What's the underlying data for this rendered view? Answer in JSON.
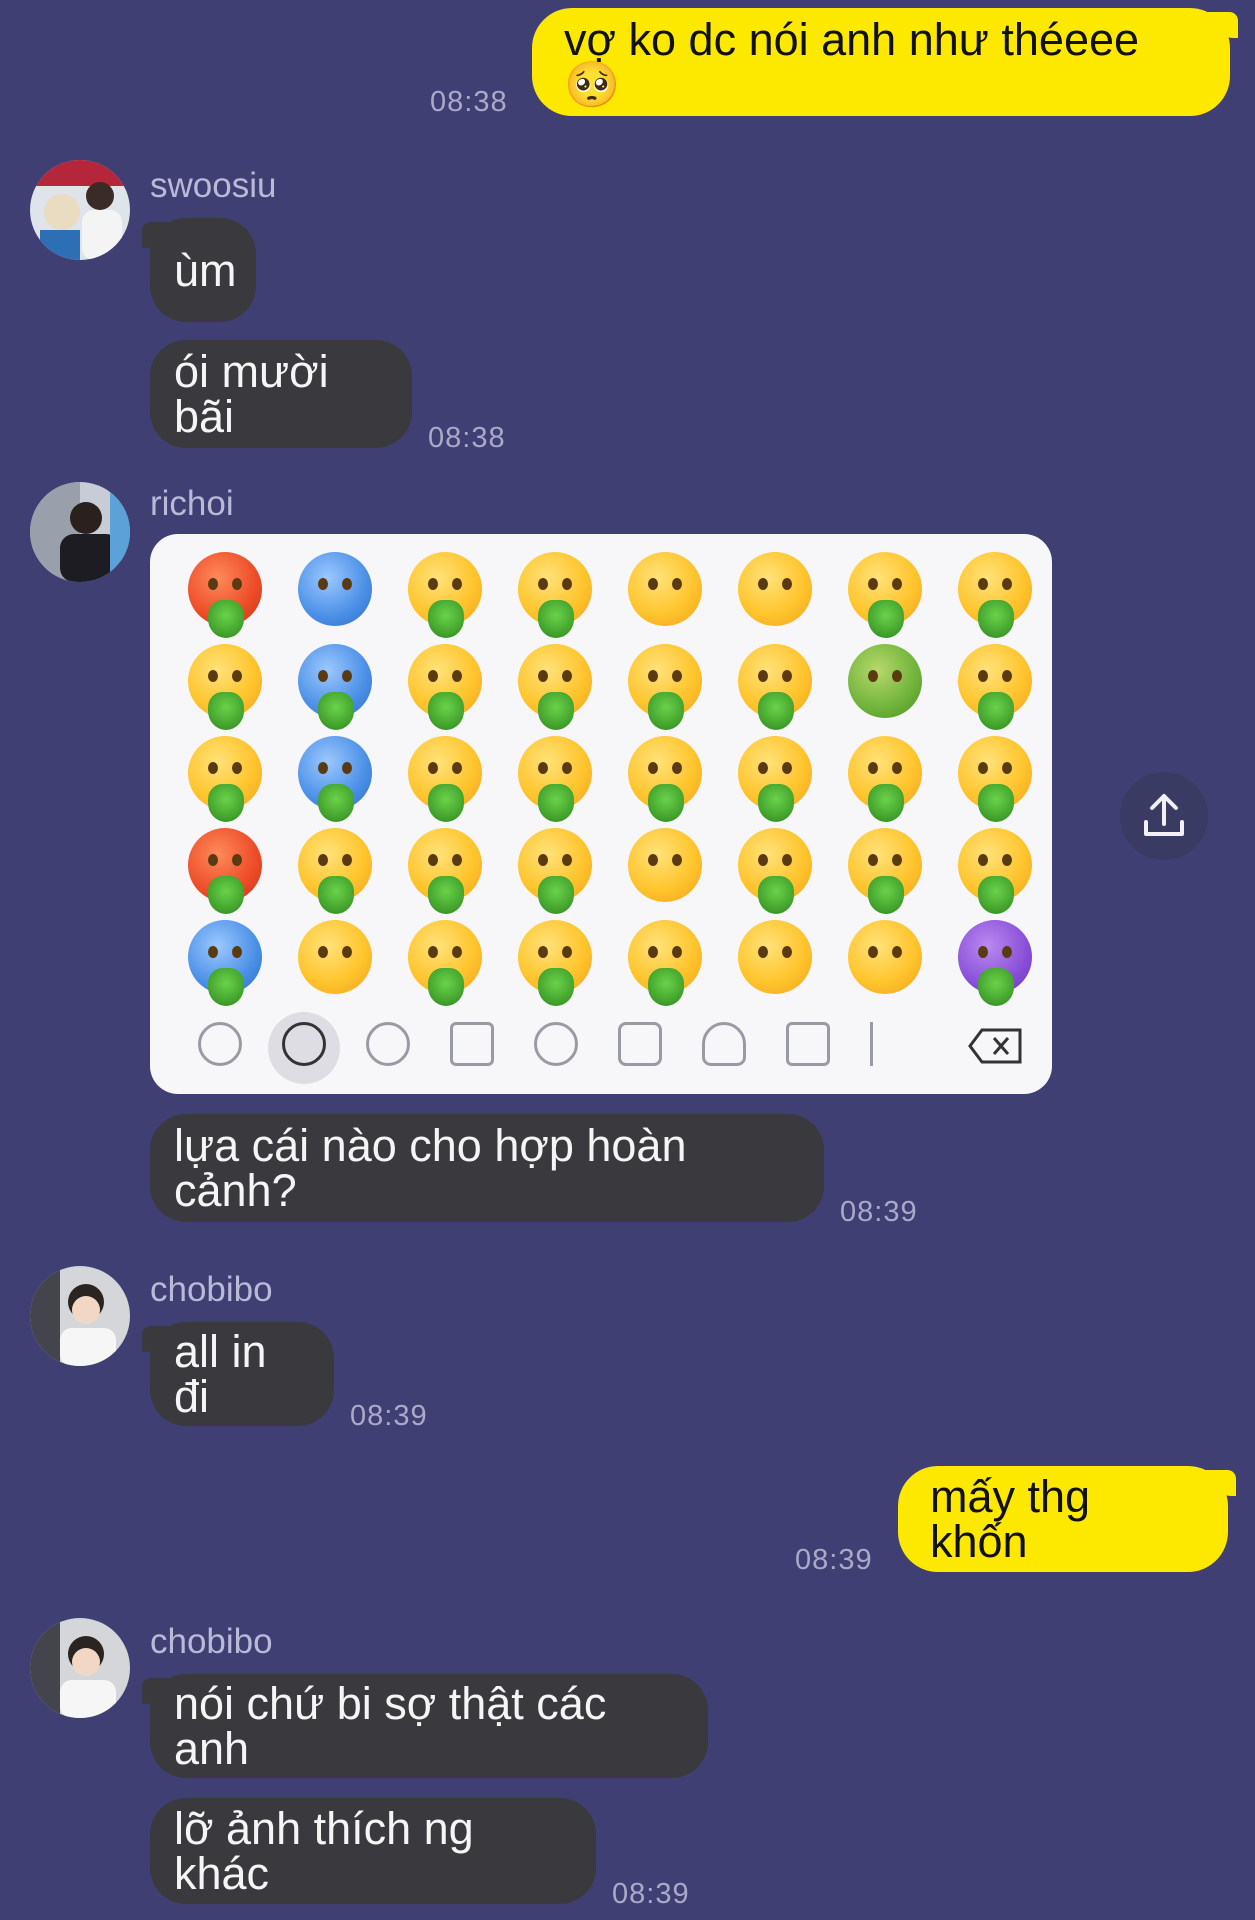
{
  "colors": {
    "background": "#3f3f74",
    "outgoing_bubble": "#fde900",
    "incoming_bubble": "#3a3a3e",
    "timestamp": "#a9a9c8"
  },
  "messages": [
    {
      "id": "m1",
      "direction": "out",
      "text": "vợ ko dc nói anh như théeee 🥺",
      "time": "08:38"
    },
    {
      "id": "m2",
      "direction": "in",
      "sender": "swoosiu",
      "text": "ùm"
    },
    {
      "id": "m3",
      "direction": "in",
      "sender": "swoosiu",
      "text": "ói mười bãi",
      "time": "08:38"
    },
    {
      "id": "m4",
      "direction": "in",
      "sender": "richoi",
      "type": "image",
      "description": "emoji-keyboard-screenshot"
    },
    {
      "id": "m5",
      "direction": "in",
      "sender": "richoi",
      "text": "lựa cái nào cho hợp hoàn cảnh?",
      "time": "08:39"
    },
    {
      "id": "m6",
      "direction": "in",
      "sender": "chobibo",
      "text": "all in đi",
      "time": "08:39"
    },
    {
      "id": "m7",
      "direction": "out",
      "text": "mấy thg khốn",
      "time": "08:39"
    },
    {
      "id": "m8",
      "direction": "in",
      "sender": "chobibo",
      "text": "nói chứ bi sợ thật các anh"
    },
    {
      "id": "m9",
      "direction": "in",
      "sender": "chobibo",
      "text": "lỡ ảnh thích ng khác",
      "time": "08:39"
    }
  ],
  "senders": {
    "swoosiu": "swoosiu",
    "richoi": "richoi",
    "chobibo1": "chobibo",
    "chobibo2": "chobibo"
  },
  "icons": {
    "share": "share-icon",
    "keyboard_tabs": [
      "clock-icon",
      "smiley-icon",
      "bear-icon",
      "food-icon",
      "ball-icon",
      "car-icon",
      "bulb-icon",
      "symbols-icon",
      "flag-icon",
      "backspace-icon"
    ]
  }
}
